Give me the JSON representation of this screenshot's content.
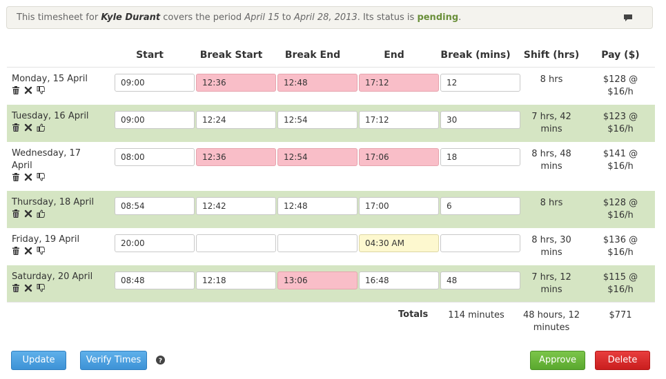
{
  "banner": {
    "prefix": "This timesheet for ",
    "employee": "Kyle Durant",
    "mid1": " covers the period ",
    "start_date": "April 15",
    "mid2": " to ",
    "end_date": "April 28, 2013",
    "mid3": ". Its status is ",
    "status": "pending",
    "suffix": "."
  },
  "columns": {
    "start": "Start",
    "break_start": "Break Start",
    "break_end": "Break End",
    "end": "End",
    "break_mins": "Break (mins)",
    "shift": "Shift (hrs)",
    "pay": "Pay ($)"
  },
  "rows": [
    {
      "day": "Monday, 15 April",
      "start": "09:00",
      "break_start": "12:36",
      "break_end": "12:48",
      "end": "17:12",
      "break_mins": "12",
      "shift": [
        "8 hrs"
      ],
      "pay": [
        "$128 @",
        "$16/h"
      ],
      "thumb": "down",
      "highlight": {
        "break_start": "error",
        "break_end": "error",
        "end": "error"
      }
    },
    {
      "day": "Tuesday, 16 April",
      "start": "09:00",
      "break_start": "12:24",
      "break_end": "12:54",
      "end": "17:12",
      "break_mins": "30",
      "shift": [
        "7 hrs, 42",
        "mins"
      ],
      "pay": [
        "$123 @",
        "$16/h"
      ],
      "thumb": "up",
      "highlight": {}
    },
    {
      "day": "Wednesday, 17 April",
      "start": "08:00",
      "break_start": "12:36",
      "break_end": "12:54",
      "end": "17:06",
      "break_mins": "18",
      "shift": [
        "8 hrs, 48",
        "mins"
      ],
      "pay": [
        "$141 @",
        "$16/h"
      ],
      "thumb": "down",
      "highlight": {
        "break_start": "error",
        "break_end": "error",
        "end": "error"
      }
    },
    {
      "day": "Thursday, 18 April",
      "start": "08:54",
      "break_start": "12:42",
      "break_end": "12:48",
      "end": "17:00",
      "break_mins": "6",
      "shift": [
        "8 hrs"
      ],
      "pay": [
        "$128 @",
        "$16/h"
      ],
      "thumb": "up",
      "highlight": {}
    },
    {
      "day": "Friday, 19 April",
      "start": "20:00",
      "break_start": "",
      "break_end": "",
      "end": "04:30 AM",
      "break_mins": "",
      "shift": [
        "8 hrs, 30",
        "mins"
      ],
      "pay": [
        "$136 @",
        "$16/h"
      ],
      "thumb": "down",
      "highlight": {
        "end": "warning"
      }
    },
    {
      "day": "Saturday, 20 April",
      "start": "08:48",
      "break_start": "12:18",
      "break_end": "13:06",
      "end": "16:48",
      "break_mins": "48",
      "shift": [
        "7 hrs, 12",
        "mins"
      ],
      "pay": [
        "$115 @",
        "$16/h"
      ],
      "thumb": "down",
      "highlight": {
        "break_end": "error"
      }
    }
  ],
  "totals": {
    "label": "Totals",
    "break": "114 minutes",
    "shift": [
      "48 hours, 12",
      "minutes"
    ],
    "pay": "$771"
  },
  "buttons": {
    "update": "Update",
    "verify": "Verify Times",
    "approve": "Approve",
    "delete": "Delete"
  },
  "colors": {
    "alt_row": "#d5e5c3",
    "error_field": "#f9bec8",
    "warning_field": "#fdf8cf",
    "status_pending": "#6a8f3a",
    "button_blue": "#3d92d6",
    "button_green": "#5aa82e",
    "button_red": "#c91e1e"
  },
  "icons": {
    "banner": "comment-icon",
    "row_actions": [
      "trash-icon",
      "close-icon",
      "thumb-icon"
    ],
    "help": "question-icon"
  }
}
